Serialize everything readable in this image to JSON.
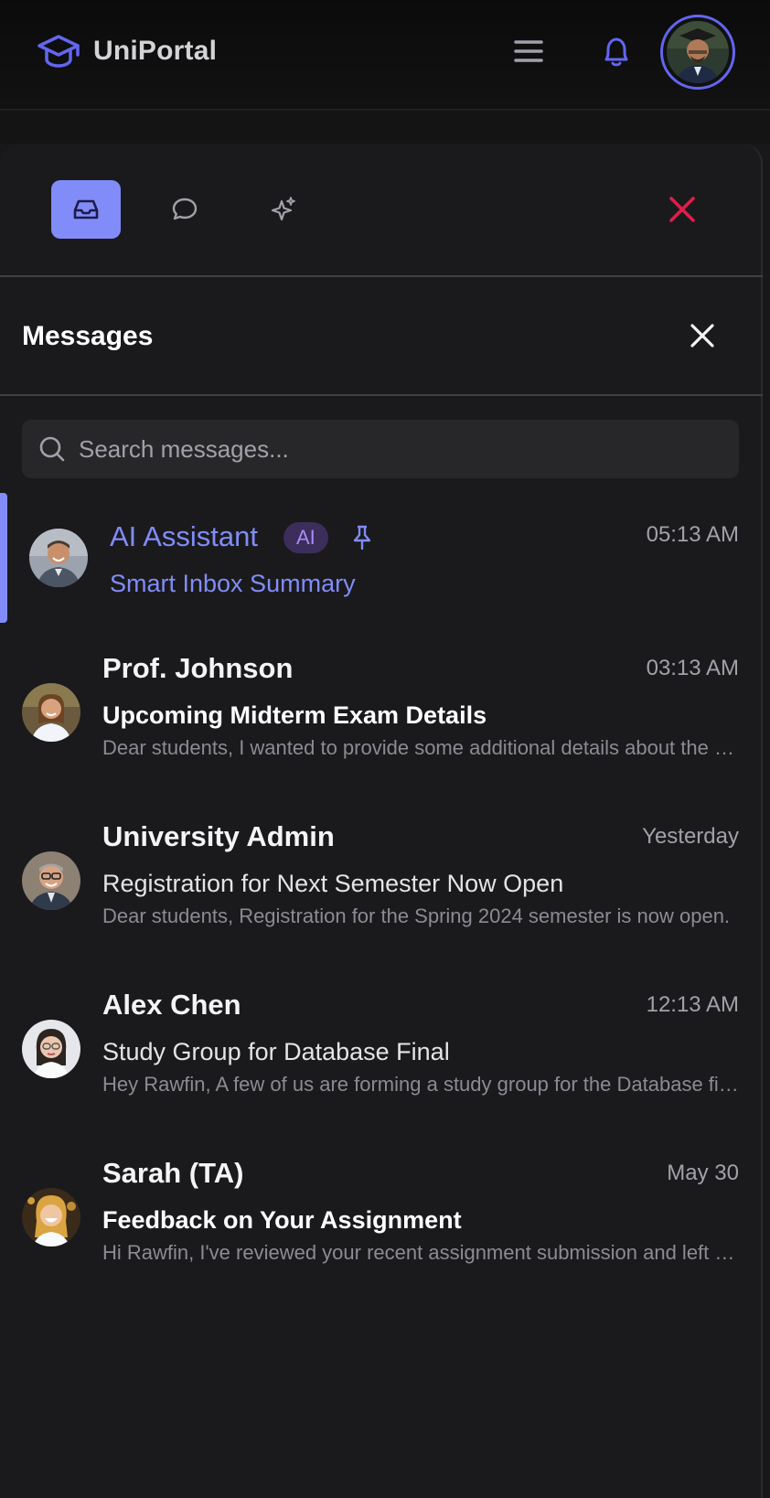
{
  "app": {
    "brand_name": "UniPortal"
  },
  "colors": {
    "accent": "#818cf8",
    "close_red": "#e11d48",
    "background": "#18181b"
  },
  "panel": {
    "tabs": [
      {
        "icon": "inbox-icon",
        "active": true
      },
      {
        "icon": "chat-bubble-icon",
        "active": false
      },
      {
        "icon": "sparkles-icon",
        "active": false
      }
    ]
  },
  "messages_panel": {
    "title": "Messages",
    "search": {
      "placeholder": "Search messages..."
    },
    "items": [
      {
        "sender": "AI Assistant",
        "badge": "AI",
        "pinned": true,
        "time": "05:13 AM",
        "subject": "Smart Inbox Summary",
        "preview": ""
      },
      {
        "sender": "Prof. Johnson",
        "time": "03:13 AM",
        "subject": "Upcoming Midterm Exam Details",
        "unread": true,
        "preview": "Dear students, I wanted to provide some additional details about the upcoming midterm exam."
      },
      {
        "sender": "University Admin",
        "time": "Yesterday",
        "subject": "Registration for Next Semester Now Open",
        "unread": false,
        "preview": "Dear students, Registration for the Spring 2024 semester is now open."
      },
      {
        "sender": "Alex Chen",
        "time": "12:13 AM",
        "subject": "Study Group for Database Final",
        "unread": false,
        "preview": "Hey Rawfin, A few of us are forming a study group for the Database final."
      },
      {
        "sender": "Sarah (TA)",
        "time": "May 30",
        "subject": "Feedback on Your Assignment",
        "unread": true,
        "preview": "Hi Rawfin, I've reviewed your recent assignment submission and left some comments."
      }
    ]
  }
}
